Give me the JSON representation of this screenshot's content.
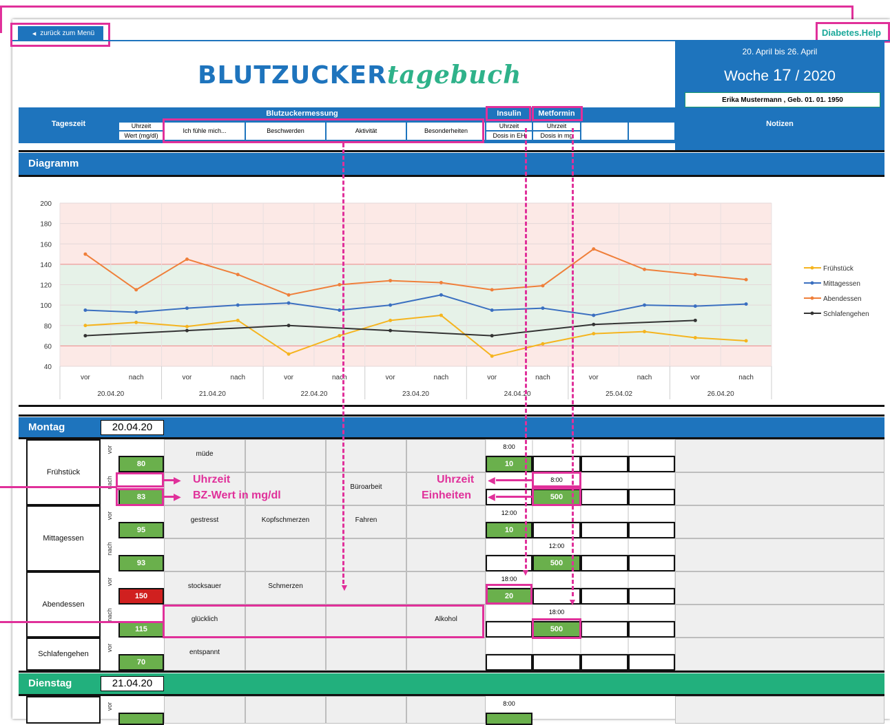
{
  "nav": {
    "back_label": "zurück zum Menü",
    "brand": "Diabetes.Help"
  },
  "header": {
    "title_part1": "BLUTZUCKER",
    "title_part2": "tagebuch",
    "range": "20. April bis 26. April",
    "week_prefix": "Woche",
    "week_number": "17",
    "week_suffix": "/ 2020",
    "patient": "Erika Mustermann , Geb. 01. 01. 1950"
  },
  "columns": {
    "tageszeit": "Tageszeit",
    "blutzuckermessung": "Blutzuckermessung",
    "uhrzeit": "Uhrzeit",
    "wert": "Wert (mg/dl)",
    "fuehle": "Ich fühle mich...",
    "beschwerden": "Beschwerden",
    "aktivitaet": "Aktivität",
    "besonderheiten": "Besonderheiten",
    "insulin": "Insulin",
    "metformin": "Metformin",
    "ins_uhrzeit": "Uhrzeit",
    "ins_dosis": "Dosis in EH",
    "met_uhrzeit": "Uhrzeit",
    "met_dosis": "Dosis in mg",
    "notizen": "Notizen"
  },
  "diagram_label": "Diagramm",
  "chart_data": {
    "type": "line",
    "x": [
      "vor",
      "nach",
      "vor",
      "nach",
      "vor",
      "nach",
      "vor",
      "nach",
      "vor",
      "nach",
      "vor",
      "nach",
      "vor",
      "nach"
    ],
    "groups": [
      "20.04.20",
      "21.04.20",
      "22.04.20",
      "23.04.20",
      "24.04.20",
      "25.04.02",
      "26.04.20"
    ],
    "ylim": [
      40,
      200
    ],
    "yticks": [
      40,
      60,
      80,
      100,
      120,
      140,
      160,
      180,
      200
    ],
    "bands": {
      "target_low": 60,
      "target_high": 140
    },
    "series": [
      {
        "name": "Frühstück",
        "color": "#f5b41e",
        "values": [
          80,
          83,
          79,
          85,
          52,
          70,
          85,
          90,
          50,
          62,
          72,
          74,
          68,
          65
        ]
      },
      {
        "name": "Mittagessen",
        "color": "#3a6fc0",
        "values": [
          95,
          93,
          97,
          100,
          102,
          95,
          100,
          110,
          95,
          97,
          90,
          100,
          99,
          101
        ]
      },
      {
        "name": "Abendessen",
        "color": "#ef7f3a",
        "values": [
          150,
          115,
          145,
          130,
          110,
          120,
          124,
          122,
          115,
          119,
          155,
          135,
          130,
          125
        ]
      },
      {
        "name": "Schlafengehen",
        "color": "#333333",
        "values": [
          70,
          null,
          75,
          null,
          80,
          null,
          75,
          null,
          70,
          null,
          81,
          null,
          85,
          null
        ]
      }
    ],
    "grid": true,
    "legend": "right"
  },
  "days": [
    {
      "name": "Montag",
      "date": "20.04.20",
      "color": "#1e74bd",
      "meals": [
        {
          "label": "Frühstück",
          "vor_val": "80",
          "nach_val": "83",
          "feel": "müde",
          "beschw": "",
          "akt_nach": "Büroarbeit",
          "ins_time": "8:00",
          "ins_dose": "10",
          "met_time": "8:00",
          "met_dose": "500"
        },
        {
          "label": "Mittagessen",
          "vor_val": "95",
          "nach_val": "93",
          "feel": "gestresst",
          "beschw": "Kopfschmerzen",
          "akt": "Fahren",
          "ins_time": "12:00",
          "ins_dose": "10",
          "met_time": "12:00",
          "met_dose": "500"
        },
        {
          "label": "Abendessen",
          "vor_val": "150",
          "nach_val": "115",
          "feel": "stocksauer",
          "beschw": "Schmerzen",
          "feel_nach": "glücklich",
          "bes_nach": "Alkohol",
          "ins_time": "18:00",
          "ins_dose": "20",
          "met_time": "18:00",
          "met_dose": "500"
        },
        {
          "label": "Schlafengehen",
          "vor_val": "70",
          "feel": "entspannt"
        }
      ]
    },
    {
      "name": "Dienstag",
      "date": "21.04.20",
      "color": "#22b07d",
      "first_time": "8:00"
    }
  ],
  "rot_labels": {
    "vor": "vor",
    "nach": "nach"
  },
  "annotations": {
    "uhrzeit": "Uhrzeit",
    "bz_wert": "BZ-Wert in mg/dl",
    "uhrzeit_right": "Uhrzeit",
    "einheiten": "Einheiten"
  }
}
